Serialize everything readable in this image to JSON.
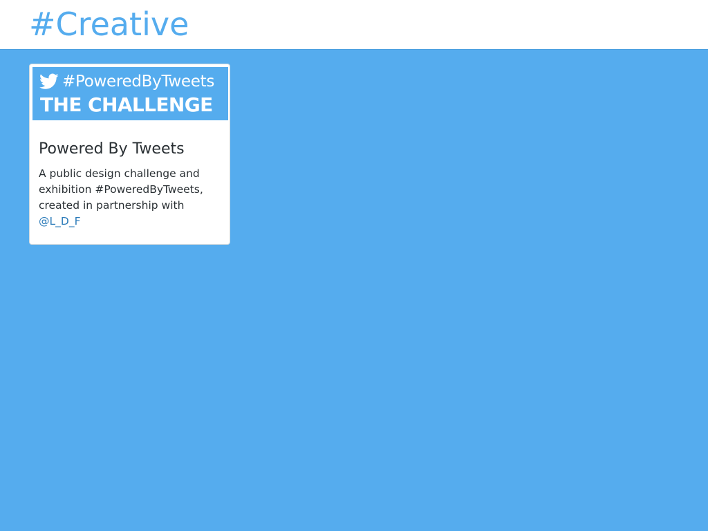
{
  "header": {
    "title": "#Creative"
  },
  "cards": [
    {
      "image": {
        "icon": "twitter-bird-icon",
        "hashtag": "#PoweredByTweets",
        "headline": "THE CHALLENGE",
        "background": "#55acee"
      },
      "title": "Powered By Tweets",
      "description": "A public design challenge and exhibition #PoweredByTweets, created in partnership with",
      "mention": "@L_D_F"
    }
  ],
  "colors": {
    "page_background": "#55acee",
    "accent": "#55acee",
    "link": "#2b7bb9",
    "text": "#292f33"
  }
}
